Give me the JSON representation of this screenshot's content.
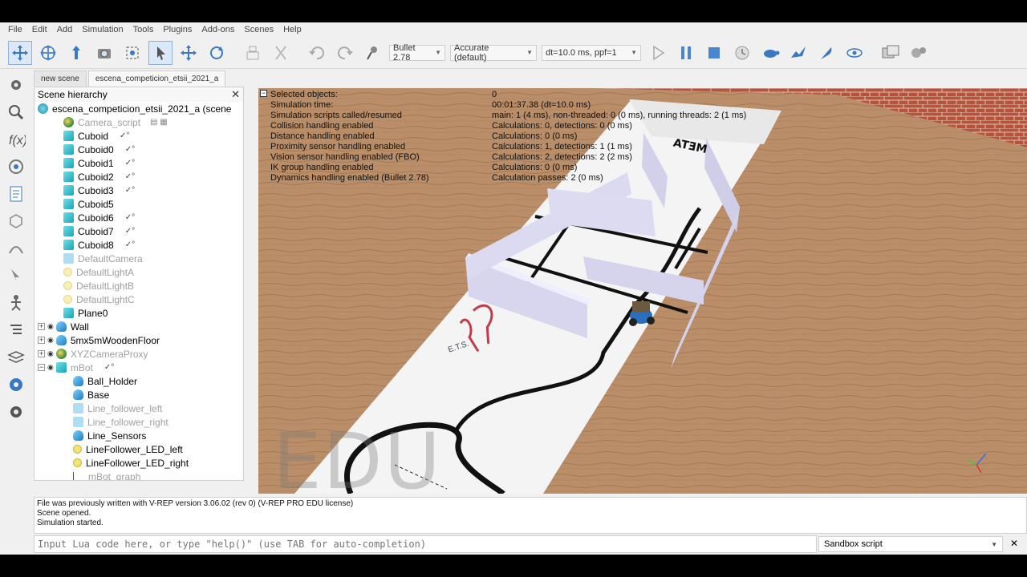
{
  "menu": [
    "File",
    "Edit",
    "Add",
    "Simulation",
    "Tools",
    "Plugins",
    "Add-ons",
    "Scenes",
    "Help"
  ],
  "toolbar": {
    "engine": "Bullet 2.78",
    "accuracy": "Accurate (default)",
    "timestep": "dt=10.0 ms, ppf=1"
  },
  "tabs": [
    "new scene",
    "escena_competicion_etsii_2021_a"
  ],
  "hierarchy": {
    "title": "Scene hierarchy",
    "root": "escena_competicion_etsii_2021_a (scene",
    "items": [
      {
        "label": "Camera_script",
        "dim": true
      },
      {
        "label": "Cuboid"
      },
      {
        "label": "Cuboid0"
      },
      {
        "label": "Cuboid1"
      },
      {
        "label": "Cuboid2"
      },
      {
        "label": "Cuboid3"
      },
      {
        "label": "Cuboid5"
      },
      {
        "label": "Cuboid6"
      },
      {
        "label": "Cuboid7"
      },
      {
        "label": "Cuboid8"
      },
      {
        "label": "DefaultCamera",
        "dim": true
      },
      {
        "label": "DefaultLightA",
        "dim": true
      },
      {
        "label": "DefaultLightB",
        "dim": true
      },
      {
        "label": "DefaultLightC",
        "dim": true
      },
      {
        "label": "Plane0"
      },
      {
        "label": "Wall"
      },
      {
        "label": "5mx5mWoodenFloor"
      },
      {
        "label": "XYZCameraProxy",
        "dim": true
      },
      {
        "label": "mBot",
        "dim": true
      },
      {
        "label": "Ball_Holder"
      },
      {
        "label": "Base"
      },
      {
        "label": "Line_follower_left",
        "dim": true
      },
      {
        "label": "Line_follower_right",
        "dim": true
      },
      {
        "label": "Line_Sensors"
      },
      {
        "label": "LineFollower_LED_left"
      },
      {
        "label": "LineFollower_LED_right"
      },
      {
        "label": "mBot_graph",
        "dim": true
      }
    ]
  },
  "info": {
    "left": [
      "Selected objects:",
      "Simulation time:",
      "Simulation scripts called/resumed",
      "Collision handling enabled",
      "Distance handling enabled",
      "Proximity sensor handling enabled",
      "Vision sensor handling enabled (FBO)",
      "IK group handling enabled",
      "Dynamics handling enabled (Bullet 2.78)"
    ],
    "right": [
      "0",
      "00:01:37.38 (dt=10.0 ms)",
      "main: 1 (4 ms), non-threaded: 0 (0 ms), running threads: 2 (1 ms)",
      "Calculations: 0, detections: 0 (0 ms)",
      "Calculations: 0 (0 ms)",
      "Calculations: 1, detections: 1 (1 ms)",
      "Calculations: 2, detections: 2 (2 ms)",
      "Calculations: 0 (0 ms)",
      "Calculation passes: 2 (0 ms)"
    ]
  },
  "watermark": "EDU",
  "scene_text": {
    "meta": "META",
    "logo": "E.T.S."
  },
  "status": {
    "lines": [
      "File was previously written with V-REP version 3.06.02 (rev 0) (V-REP PRO EDU license)",
      "Scene opened.",
      "Simulation started."
    ]
  },
  "command": {
    "placeholder": "Input Lua code here, or type \"help()\" (use TAB for auto-completion)",
    "sandbox": "Sandbox script"
  }
}
